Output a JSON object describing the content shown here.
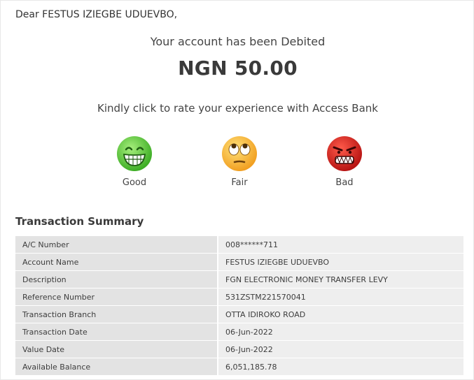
{
  "greeting": "Dear FESTUS IZIEGBE UDUEVBO,",
  "headline": "Your account has been Debited",
  "amount": "NGN 50.00",
  "rate_prompt": "Kindly click to rate your experience with Access Bank",
  "ratings": [
    {
      "label": "Good",
      "icon": "grinning-face-icon"
    },
    {
      "label": "Fair",
      "icon": "rolling-eyes-face-icon"
    },
    {
      "label": "Bad",
      "icon": "angry-face-icon"
    }
  ],
  "summary": {
    "title": "Transaction Summary",
    "rows": [
      {
        "label": "A/C Number",
        "value": "008******711"
      },
      {
        "label": "Account Name",
        "value": "FESTUS IZIEGBE UDUEVBO"
      },
      {
        "label": "Description",
        "value": "FGN ELECTRONIC MONEY TRANSFER LEVY"
      },
      {
        "label": "Reference Number",
        "value": "531ZSTM221570041"
      },
      {
        "label": "Transaction Branch",
        "value": "OTTA IDIROKO ROAD"
      },
      {
        "label": "Transaction Date",
        "value": "06-Jun-2022"
      },
      {
        "label": "Value Date",
        "value": "06-Jun-2022"
      },
      {
        "label": "Available Balance",
        "value": "6,051,185.78"
      }
    ]
  },
  "colors": {
    "good": "#5ccb3c",
    "fair": "#f6b73c",
    "bad": "#e52b2b"
  }
}
